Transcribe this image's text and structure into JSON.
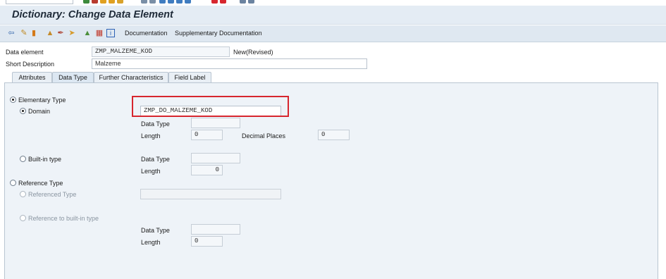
{
  "window": {
    "title": "Dictionary: Change Data Element"
  },
  "toolbar": {
    "icons": [
      "back-icon",
      "toggle-change-icon",
      "activate-icon",
      "where-used-icon",
      "edit-icon",
      "object-list-icon",
      "hierarchy-icon",
      "transport-icon",
      "info-icon"
    ],
    "documentation": "Documentation",
    "supplementary_documentation": "Supplementary Documentation"
  },
  "header": {
    "data_element_label": "Data element",
    "data_element_value": "ZMP_MALZEME_KOD",
    "status": "New(Revised)",
    "short_description_label": "Short Description",
    "short_description_value": "Malzeme"
  },
  "tabs": [
    {
      "label": "Attributes",
      "active": false
    },
    {
      "label": "Data Type",
      "active": true
    },
    {
      "label": "Further Characteristics",
      "active": false
    },
    {
      "label": "Field Label",
      "active": false
    }
  ],
  "data_type_tab": {
    "elementary_type": {
      "label": "Elementary Type",
      "selected": true
    },
    "domain": {
      "label": "Domain",
      "selected": true,
      "value": "ZMP_DO_MALZEME_KOD",
      "data_type_label": "Data Type",
      "data_type_value": "",
      "length_label": "Length",
      "length_value": "0",
      "decimal_places_label": "Decimal Places",
      "decimal_places_value": "0"
    },
    "builtin_type": {
      "label": "Built-in type",
      "selected": false,
      "data_type_label": "Data Type",
      "data_type_value": "",
      "length_label": "Length",
      "length_value": "0"
    },
    "reference_type": {
      "label": "Reference Type",
      "selected": false
    },
    "referenced_type": {
      "label": "Referenced Type",
      "selected": false,
      "value": ""
    },
    "reference_builtin": {
      "label": "Reference to built-in type",
      "selected": false,
      "data_type_label": "Data Type",
      "data_type_value": "",
      "length_label": "Length",
      "length_value": "0"
    }
  },
  "colors": {
    "highlight": "#d7262e",
    "titlebar": "#e4ecf4",
    "panel": "#eef3f8"
  }
}
